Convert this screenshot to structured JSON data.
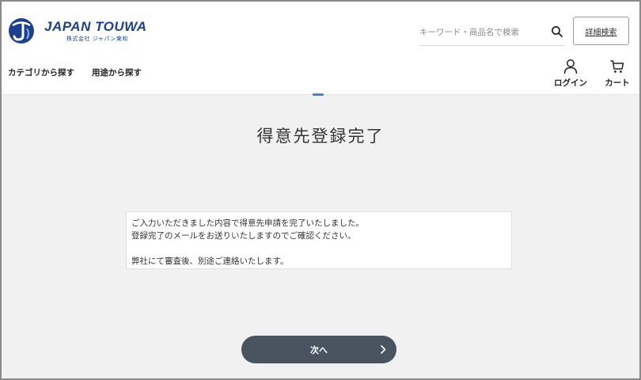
{
  "header": {
    "logo": {
      "name": "JAPAN TOUWA",
      "subtitle": "株式会社 ジャパン東和"
    },
    "search": {
      "placeholder": "キーワード・商品名で検索",
      "value": ""
    },
    "advanced_search_label": "詳細検索",
    "nav": {
      "category_label": "カテゴリから探す",
      "purpose_label": "用途から探す"
    },
    "login_label": "ログイン",
    "cart_label": "カート"
  },
  "main": {
    "title": "得意先登録完了",
    "message": {
      "line1": "ご入力いただきました内容で得意先申請を完了いたしました。",
      "line2": "登録完了のメールをお送りいたしますのでご確認ください。",
      "line3": "弊社にて審査後、別途ご連絡いたします。"
    },
    "next_button_label": "次へ"
  },
  "colors": {
    "brand": "#1c3f8e",
    "button_bg": "#4a5461",
    "page_bg": "#f1f1f1"
  }
}
